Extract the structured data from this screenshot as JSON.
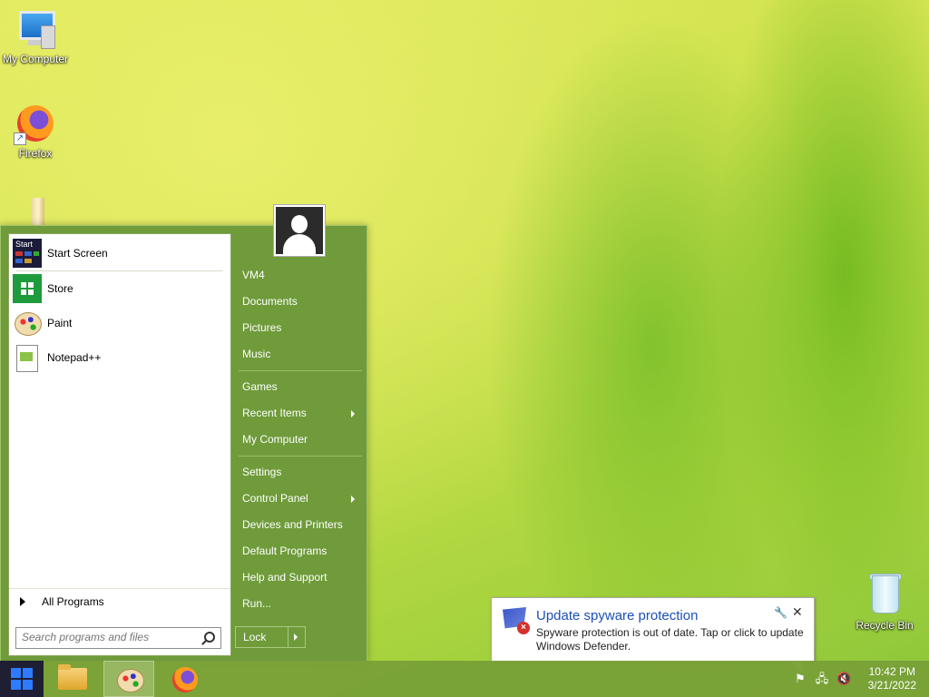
{
  "desktop": {
    "icons": [
      {
        "label": "My Computer",
        "icon": "computer-icon"
      },
      {
        "label": "Firefox",
        "icon": "firefox-icon"
      },
      {
        "label": "Recycle Bin",
        "icon": "recycle-bin-icon"
      }
    ]
  },
  "start_menu": {
    "programs": [
      {
        "label": "Start Screen",
        "icon": "start-screen-icon"
      },
      {
        "label": "Store",
        "icon": "store-icon"
      },
      {
        "label": "Paint",
        "icon": "paint-icon"
      },
      {
        "label": "Notepad++",
        "icon": "notepadpp-icon"
      }
    ],
    "all_programs": "All Programs",
    "search_placeholder": "Search programs and files",
    "right_items": {
      "user": "VM4",
      "documents": "Documents",
      "pictures": "Pictures",
      "music": "Music",
      "games": "Games",
      "recent_items": "Recent Items",
      "my_computer": "My Computer",
      "settings": "Settings",
      "control_panel": "Control Panel",
      "devices_printers": "Devices and Printers",
      "default_programs": "Default Programs",
      "help_support": "Help and Support",
      "run": "Run..."
    },
    "lock_label": "Lock",
    "start_tile_text": "Start"
  },
  "notification": {
    "title": "Update spyware protection",
    "message": "Spyware protection is out of date. Tap or click to update Windows Defender."
  },
  "taskbar": {
    "time": "10:42 PM",
    "date": "3/21/2022",
    "pinned": [
      "file-explorer-icon",
      "paint-icon",
      "firefox-icon"
    ]
  },
  "colors": {
    "start_menu_bg": "#6f9b3a",
    "taskbar_bg": "#78a037",
    "start_button_bg": "#1f1f33",
    "notification_title": "#1c4fb8"
  }
}
